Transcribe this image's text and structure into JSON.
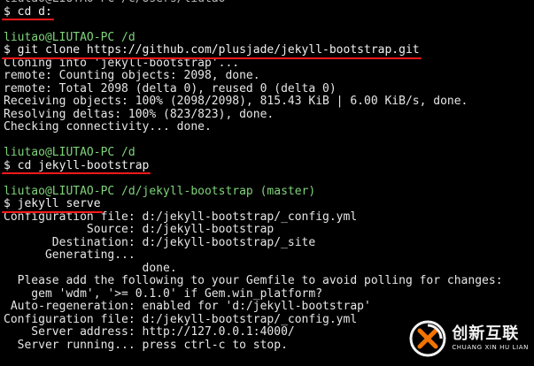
{
  "terminal": {
    "line0": "$ cd d:",
    "prompt1": "liutao@LIUTAO-PC /d",
    "cmd1": "$ git clone https://github.com/plusjade/jekyll-bootstrap.git",
    "out1": [
      "Cloning into 'jekyll-bootstrap'...",
      "remote: Counting objects: 2098, done.",
      "remote: Total 2098 (delta 0), reused 0 (delta 0)",
      "Receiving objects: 100% (2098/2098), 815.43 KiB | 6.00 KiB/s, done.",
      "Resolving deltas: 100% (823/823), done.",
      "Checking connectivity... done."
    ],
    "prompt2": "liutao@LIUTAO-PC /d",
    "cmd2": "$ cd jekyll-bootstrap",
    "prompt3_user": "liutao@LIUTAO-PC /d/jekyll-bootstrap (master)",
    "cmd3": "$ jekyll serve",
    "out3": [
      "Configuration file: d:/jekyll-bootstrap/_config.yml",
      "            Source: d:/jekyll-bootstrap",
      "       Destination: d:/jekyll-bootstrap/_site",
      "      Generating...",
      "                    done.",
      "  Please add the following to your Gemfile to avoid polling for changes:",
      "    gem 'wdm', '>= 0.1.0' if Gem.win_platform?",
      " Auto-regeneration: enabled for 'd:/jekyll-bootstrap'",
      "Configuration file: d:/jekyll-bootstrap/_config.yml",
      "    Server address: http://127.0.0.1:4000/",
      "  Server running... press ctrl-c to stop."
    ]
  },
  "watermark": {
    "title": "创新互联",
    "subtitle": "CHUANG XIN HU LIAN",
    "icon": "chuangxin-logo-icon"
  }
}
